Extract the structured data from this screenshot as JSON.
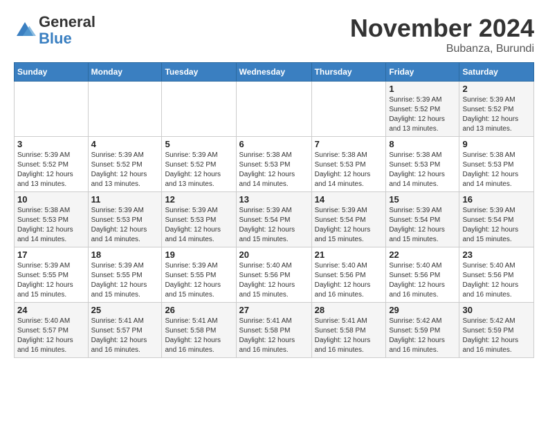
{
  "header": {
    "logo_general": "General",
    "logo_blue": "Blue",
    "month_title": "November 2024",
    "location": "Bubanza, Burundi"
  },
  "weekdays": [
    "Sunday",
    "Monday",
    "Tuesday",
    "Wednesday",
    "Thursday",
    "Friday",
    "Saturday"
  ],
  "weeks": [
    [
      {
        "day": "",
        "info": ""
      },
      {
        "day": "",
        "info": ""
      },
      {
        "day": "",
        "info": ""
      },
      {
        "day": "",
        "info": ""
      },
      {
        "day": "",
        "info": ""
      },
      {
        "day": "1",
        "info": "Sunrise: 5:39 AM\nSunset: 5:52 PM\nDaylight: 12 hours\nand 13 minutes."
      },
      {
        "day": "2",
        "info": "Sunrise: 5:39 AM\nSunset: 5:52 PM\nDaylight: 12 hours\nand 13 minutes."
      }
    ],
    [
      {
        "day": "3",
        "info": "Sunrise: 5:39 AM\nSunset: 5:52 PM\nDaylight: 12 hours\nand 13 minutes."
      },
      {
        "day": "4",
        "info": "Sunrise: 5:39 AM\nSunset: 5:52 PM\nDaylight: 12 hours\nand 13 minutes."
      },
      {
        "day": "5",
        "info": "Sunrise: 5:39 AM\nSunset: 5:52 PM\nDaylight: 12 hours\nand 13 minutes."
      },
      {
        "day": "6",
        "info": "Sunrise: 5:38 AM\nSunset: 5:53 PM\nDaylight: 12 hours\nand 14 minutes."
      },
      {
        "day": "7",
        "info": "Sunrise: 5:38 AM\nSunset: 5:53 PM\nDaylight: 12 hours\nand 14 minutes."
      },
      {
        "day": "8",
        "info": "Sunrise: 5:38 AM\nSunset: 5:53 PM\nDaylight: 12 hours\nand 14 minutes."
      },
      {
        "day": "9",
        "info": "Sunrise: 5:38 AM\nSunset: 5:53 PM\nDaylight: 12 hours\nand 14 minutes."
      }
    ],
    [
      {
        "day": "10",
        "info": "Sunrise: 5:38 AM\nSunset: 5:53 PM\nDaylight: 12 hours\nand 14 minutes."
      },
      {
        "day": "11",
        "info": "Sunrise: 5:39 AM\nSunset: 5:53 PM\nDaylight: 12 hours\nand 14 minutes."
      },
      {
        "day": "12",
        "info": "Sunrise: 5:39 AM\nSunset: 5:53 PM\nDaylight: 12 hours\nand 14 minutes."
      },
      {
        "day": "13",
        "info": "Sunrise: 5:39 AM\nSunset: 5:54 PM\nDaylight: 12 hours\nand 15 minutes."
      },
      {
        "day": "14",
        "info": "Sunrise: 5:39 AM\nSunset: 5:54 PM\nDaylight: 12 hours\nand 15 minutes."
      },
      {
        "day": "15",
        "info": "Sunrise: 5:39 AM\nSunset: 5:54 PM\nDaylight: 12 hours\nand 15 minutes."
      },
      {
        "day": "16",
        "info": "Sunrise: 5:39 AM\nSunset: 5:54 PM\nDaylight: 12 hours\nand 15 minutes."
      }
    ],
    [
      {
        "day": "17",
        "info": "Sunrise: 5:39 AM\nSunset: 5:55 PM\nDaylight: 12 hours\nand 15 minutes."
      },
      {
        "day": "18",
        "info": "Sunrise: 5:39 AM\nSunset: 5:55 PM\nDaylight: 12 hours\nand 15 minutes."
      },
      {
        "day": "19",
        "info": "Sunrise: 5:39 AM\nSunset: 5:55 PM\nDaylight: 12 hours\nand 15 minutes."
      },
      {
        "day": "20",
        "info": "Sunrise: 5:40 AM\nSunset: 5:56 PM\nDaylight: 12 hours\nand 15 minutes."
      },
      {
        "day": "21",
        "info": "Sunrise: 5:40 AM\nSunset: 5:56 PM\nDaylight: 12 hours\nand 16 minutes."
      },
      {
        "day": "22",
        "info": "Sunrise: 5:40 AM\nSunset: 5:56 PM\nDaylight: 12 hours\nand 16 minutes."
      },
      {
        "day": "23",
        "info": "Sunrise: 5:40 AM\nSunset: 5:56 PM\nDaylight: 12 hours\nand 16 minutes."
      }
    ],
    [
      {
        "day": "24",
        "info": "Sunrise: 5:40 AM\nSunset: 5:57 PM\nDaylight: 12 hours\nand 16 minutes."
      },
      {
        "day": "25",
        "info": "Sunrise: 5:41 AM\nSunset: 5:57 PM\nDaylight: 12 hours\nand 16 minutes."
      },
      {
        "day": "26",
        "info": "Sunrise: 5:41 AM\nSunset: 5:58 PM\nDaylight: 12 hours\nand 16 minutes."
      },
      {
        "day": "27",
        "info": "Sunrise: 5:41 AM\nSunset: 5:58 PM\nDaylight: 12 hours\nand 16 minutes."
      },
      {
        "day": "28",
        "info": "Sunrise: 5:41 AM\nSunset: 5:58 PM\nDaylight: 12 hours\nand 16 minutes."
      },
      {
        "day": "29",
        "info": "Sunrise: 5:42 AM\nSunset: 5:59 PM\nDaylight: 12 hours\nand 16 minutes."
      },
      {
        "day": "30",
        "info": "Sunrise: 5:42 AM\nSunset: 5:59 PM\nDaylight: 12 hours\nand 16 minutes."
      }
    ]
  ]
}
